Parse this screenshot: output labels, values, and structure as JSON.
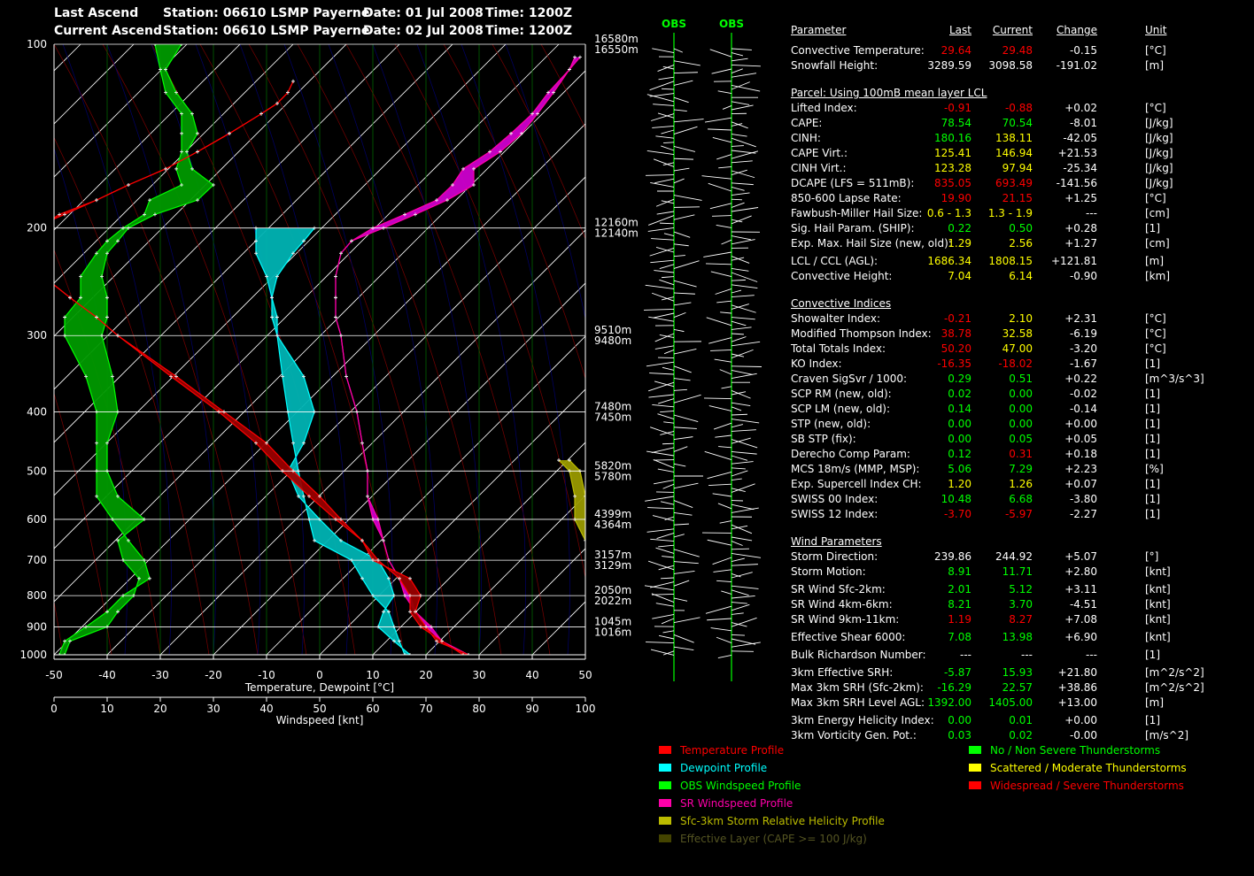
{
  "header": {
    "last_label": "Last Ascend",
    "current_label": "Current Ascend",
    "last_station": "Station: 06610 LSMP Payerne",
    "current_station": "Station: 06610 LSMP Payerne",
    "last_date": "Date: 01 Jul 2008",
    "current_date": "Date: 02 Jul 2008",
    "last_time": "Time: 1200Z",
    "current_time": "Time: 1200Z"
  },
  "colors": {
    "temperature": "#ff0000",
    "dewpoint": "#00ffff",
    "obs_wind": "#00ff00",
    "sr_wind": "#ff00aa",
    "srh": "#bbbb00",
    "effective_layer": "#444400",
    "green": "#00ff00",
    "yellow": "#ffff00",
    "red": "#ff0000",
    "fill_green": "#009900",
    "fill_red": "#990000",
    "fill_cyan": "#00b3b3",
    "fill_magenta": "#cc00cc",
    "fill_blue": "#0000aa",
    "fill_olive": "#999900"
  },
  "chart_data": {
    "type": "line",
    "xlabel": "Temperature, Dewpoint  [°C]",
    "xlabel2": "Windspeed  [knt]",
    "xlim": [
      -50,
      50
    ],
    "x2lim": [
      0,
      100
    ],
    "x_ticks": [
      "-50",
      "-40",
      "-30",
      "-20",
      "-10",
      "0",
      "10",
      "20",
      "30",
      "40",
      "50"
    ],
    "x2_ticks": [
      "0",
      "10",
      "20",
      "30",
      "40",
      "50",
      "60",
      "70",
      "80",
      "90",
      "100"
    ],
    "y_scale": "log",
    "ylim": [
      100,
      1000
    ],
    "y_ticks": [
      "100",
      "200",
      "300",
      "400",
      "500",
      "600",
      "700",
      "800",
      "900",
      "1000"
    ],
    "height_labels": [
      {
        "p": 100,
        "last": "16580m",
        "current": "16550m"
      },
      {
        "p": 200,
        "last": "12160m",
        "current": "12140m"
      },
      {
        "p": 300,
        "last": "9510m",
        "current": "9480m"
      },
      {
        "p": 400,
        "last": "7480m",
        "current": "7450m"
      },
      {
        "p": 500,
        "last": "5820m",
        "current": "5780m"
      },
      {
        "p": 600,
        "last": "4399m",
        "current": "4364m"
      },
      {
        "p": 700,
        "last": "3157m",
        "current": "3129m"
      },
      {
        "p": 800,
        "last": "2050m",
        "current": "2022m"
      },
      {
        "p": 900,
        "last": "1045m",
        "current": "1016m"
      }
    ],
    "series": [
      {
        "name": "Temperature Profile",
        "p": [
          1000,
          950,
          900,
          850,
          800,
          750,
          700,
          650,
          600,
          550,
          500,
          450,
          400,
          350,
          300,
          280,
          260,
          240,
          220,
          210,
          200,
          190,
          180,
          170,
          160,
          150,
          140,
          130,
          125,
          120,
          115
        ],
        "last": [
          28,
          22,
          20,
          18,
          19,
          17,
          10,
          8,
          4,
          0,
          -5,
          -10,
          -18,
          -27,
          -38,
          -42,
          -47,
          -52,
          -57,
          -56,
          -53,
          -49,
          -42,
          -36,
          -29,
          -23,
          -17,
          -11,
          -8,
          -6,
          -5
        ],
        "current": [
          27,
          23,
          19,
          17,
          17,
          15,
          11,
          8,
          3,
          -2,
          -7,
          -12,
          -19,
          -28,
          -38,
          -42,
          -47,
          -52,
          -57,
          -56,
          -54,
          -48,
          -42,
          -36,
          -29,
          -23,
          -17,
          -11,
          -8,
          -6,
          -5
        ]
      },
      {
        "name": "Dewpoint Profile",
        "p": [
          1000,
          950,
          900,
          850,
          800,
          750,
          700,
          650,
          600,
          550,
          500,
          450,
          400,
          350,
          300,
          280,
          260,
          240,
          220,
          210,
          200
        ],
        "last": [
          16,
          15,
          14,
          13,
          10,
          8,
          6,
          -1,
          -2,
          -3,
          -4,
          -5,
          -6,
          -7,
          -8,
          -8,
          -9,
          -10,
          -12,
          -12,
          -12
        ],
        "current": [
          17,
          14,
          11,
          12,
          14,
          13,
          11,
          4,
          0,
          -4,
          -6,
          -3,
          -1,
          -3,
          -8,
          -9,
          -9,
          -8,
          -5,
          -3,
          -1
        ]
      },
      {
        "name": "OBS Windspeed Profile",
        "p": [
          1000,
          950,
          900,
          850,
          800,
          750,
          700,
          650,
          600,
          550,
          500,
          450,
          400,
          350,
          300,
          280,
          260,
          240,
          220,
          210,
          200,
          190,
          180,
          170,
          160,
          150,
          140,
          130,
          120,
          110,
          100
        ],
        "last": [
          1,
          2,
          6,
          10,
          13,
          18,
          17,
          14,
          11,
          8,
          8,
          8,
          8,
          6,
          2,
          2,
          5,
          5,
          8,
          10,
          13,
          17,
          18,
          24,
          23,
          24,
          24,
          24,
          21,
          20,
          19
        ],
        "current": [
          2,
          3,
          10,
          12,
          15,
          16,
          13,
          12,
          17,
          12,
          10,
          10,
          12,
          11,
          9,
          10,
          10,
          9,
          10,
          12,
          14,
          19,
          27,
          30,
          26,
          25,
          27,
          26,
          23,
          21,
          24
        ]
      },
      {
        "name": "SR Windspeed Profile",
        "p": [
          1000,
          950,
          900,
          850,
          800,
          750,
          700,
          650,
          600,
          550,
          500,
          450,
          400,
          350,
          300,
          280,
          260,
          240,
          220,
          210,
          200,
          190,
          180,
          170,
          160,
          150,
          140,
          130,
          120,
          110,
          105
        ],
        "last": [
          78,
          73,
          71,
          68,
          67,
          65,
          63,
          62,
          61,
          59,
          59,
          58,
          57,
          55,
          54,
          53,
          53,
          53,
          54,
          56,
          60,
          66,
          72,
          75,
          77,
          82,
          86,
          90,
          93,
          97,
          98
        ],
        "current": [
          78,
          73,
          70,
          68,
          66,
          65,
          63,
          62,
          60,
          59,
          59,
          58,
          57,
          55,
          54,
          53,
          53,
          53,
          54,
          56,
          62,
          68,
          74,
          79,
          79,
          84,
          88,
          91,
          94,
          97,
          99
        ]
      }
    ],
    "srh_band": {
      "p": [
        900,
        850,
        800,
        750,
        700,
        650,
        600,
        550,
        500,
        480
      ],
      "last": [
        57,
        57,
        57,
        58,
        57,
        50,
        48,
        48,
        47,
        45
      ],
      "current": [
        59,
        62,
        63,
        63,
        61,
        53,
        50,
        50,
        49,
        47
      ]
    },
    "wind_barbs": {
      "labels": [
        "OBS",
        "OBS"
      ]
    },
    "legend": [
      {
        "label": "Temperature Profile",
        "color": "#ff0000",
        "swatch": "#ff0000"
      },
      {
        "label": "Dewpoint Profile",
        "color": "#00ffff",
        "swatch": "#00ffff"
      },
      {
        "label": "OBS Windspeed Profile",
        "color": "#00ff00",
        "swatch": "#00ff00"
      },
      {
        "label": "SR Windspeed Profile",
        "color": "#ff00aa",
        "swatch": "#ff00aa"
      },
      {
        "label": "Sfc-3km Storm Relative Helicity Profile",
        "color": "#bbbb00",
        "swatch": "#bbbb00"
      },
      {
        "label": "Effective Layer (CAPE >= 100 J/kg)",
        "color": "#555522",
        "swatch": "#444400"
      }
    ],
    "legend2": [
      {
        "label": "No / Non Severe Thunderstorms",
        "color": "#00ff00",
        "swatch": "#00ff00"
      },
      {
        "label": "Scattered / Moderate Thunderstorms",
        "color": "#ffff00",
        "swatch": "#ffff00"
      },
      {
        "label": "Widespread / Severe Thunderstorms",
        "color": "#ff0000",
        "swatch": "#ff0000"
      }
    ]
  },
  "table": {
    "headers": {
      "param": "Parameter",
      "last": "Last",
      "current": "Current",
      "change": "Change",
      "unit": "Unit"
    },
    "rows": [
      {
        "kind": "row",
        "label": "Convective Temperature:",
        "last": "29.64",
        "current": "29.48",
        "change": "-0.15",
        "unit": "[°C]",
        "lc": "#ff0000",
        "cc": "#ff0000"
      },
      {
        "kind": "row",
        "label": "Snowfall Height:",
        "last": "3289.59",
        "current": "3098.58",
        "change": "-191.02",
        "unit": "[m]",
        "lc": "#ffffff",
        "cc": "#ffffff"
      },
      {
        "kind": "gap"
      },
      {
        "kind": "section",
        "label": "Parcel: Using 100mB mean layer LCL"
      },
      {
        "kind": "row",
        "label": "Lifted Index:",
        "last": "-0.91",
        "current": "-0.88",
        "change": "+0.02",
        "unit": "[°C]",
        "lc": "#ff0000",
        "cc": "#ff0000"
      },
      {
        "kind": "row",
        "label": "CAPE:",
        "last": "78.54",
        "current": "70.54",
        "change": "-8.01",
        "unit": "[J/kg]",
        "lc": "#00ff00",
        "cc": "#00ff00"
      },
      {
        "kind": "row",
        "label": "CINH:",
        "last": "180.16",
        "current": "138.11",
        "change": "-42.05",
        "unit": "[J/kg]",
        "lc": "#00ff00",
        "cc": "#ffff00"
      },
      {
        "kind": "row",
        "label": "CAPE Virt.:",
        "last": "125.41",
        "current": "146.94",
        "change": "+21.53",
        "unit": "[J/kg]",
        "lc": "#ffff00",
        "cc": "#ffff00"
      },
      {
        "kind": "row",
        "label": "CINH Virt.:",
        "last": "123.28",
        "current": "97.94",
        "change": "-25.34",
        "unit": "[J/kg]",
        "lc": "#ffff00",
        "cc": "#ffff00"
      },
      {
        "kind": "row",
        "label": "DCAPE (LFS = 511mB):",
        "last": "835.05",
        "current": "693.49",
        "change": "-141.56",
        "unit": "[J/kg]",
        "lc": "#ff0000",
        "cc": "#ff0000"
      },
      {
        "kind": "row",
        "label": "850-600 Lapse Rate:",
        "last": "19.90",
        "current": "21.15",
        "change": "+1.25",
        "unit": "[°C]",
        "lc": "#ff0000",
        "cc": "#ff0000"
      },
      {
        "kind": "row",
        "label": "Fawbush-Miller Hail Size:",
        "last": "0.6 - 1.3",
        "current": "1.3 - 1.9",
        "change": "---",
        "unit": "[cm]",
        "lc": "#ffff00",
        "cc": "#ffff00"
      },
      {
        "kind": "row",
        "label": "Sig. Hail Param. (SHIP):",
        "last": "0.22",
        "current": "0.50",
        "change": "+0.28",
        "unit": "[1]",
        "lc": "#00ff00",
        "cc": "#00ff00"
      },
      {
        "kind": "row",
        "label": "Exp. Max. Hail Size (new, old):",
        "last": "1.29",
        "current": "2.56",
        "change": "+1.27",
        "unit": "[cm]",
        "lc": "#ffff00",
        "cc": "#ffff00"
      },
      {
        "kind": "halfgap"
      },
      {
        "kind": "row",
        "label": "LCL / CCL (AGL):",
        "last": "1686.34",
        "current": "1808.15",
        "change": "+121.81",
        "unit": "[m]",
        "lc": "#ffff00",
        "cc": "#ffff00"
      },
      {
        "kind": "row",
        "label": "Convective Height:",
        "last": "7.04",
        "current": "6.14",
        "change": "-0.90",
        "unit": "[km]",
        "lc": "#ffff00",
        "cc": "#ffff00"
      },
      {
        "kind": "gap"
      },
      {
        "kind": "section",
        "label": "Convective Indices"
      },
      {
        "kind": "row",
        "label": "Showalter Index:",
        "last": "-0.21",
        "current": "2.10",
        "change": "+2.31",
        "unit": "[°C]",
        "lc": "#ff0000",
        "cc": "#ffff00"
      },
      {
        "kind": "row",
        "label": "Modified Thompson Index:",
        "last": "38.78",
        "current": "32.58",
        "change": "-6.19",
        "unit": "[°C]",
        "lc": "#ff0000",
        "cc": "#ffff00"
      },
      {
        "kind": "row",
        "label": "Total Totals Index:",
        "last": "50.20",
        "current": "47.00",
        "change": "-3.20",
        "unit": "[°C]",
        "lc": "#ff0000",
        "cc": "#ffff00"
      },
      {
        "kind": "row",
        "label": "KO Index:",
        "last": "-16.35",
        "current": "-18.02",
        "change": "-1.67",
        "unit": "[1]",
        "lc": "#ff0000",
        "cc": "#ff0000"
      },
      {
        "kind": "row",
        "label": "Craven SigSvr / 1000:",
        "last": "0.29",
        "current": "0.51",
        "change": "+0.22",
        "unit": "[m^3/s^3]",
        "lc": "#00ff00",
        "cc": "#00ff00"
      },
      {
        "kind": "row",
        "label": "SCP RM (new, old):",
        "last": "0.02",
        "current": "0.00",
        "change": "-0.02",
        "unit": "[1]",
        "lc": "#00ff00",
        "cc": "#00ff00"
      },
      {
        "kind": "row",
        "label": "SCP LM (new, old):",
        "last": "0.14",
        "current": "0.00",
        "change": "-0.14",
        "unit": "[1]",
        "lc": "#00ff00",
        "cc": "#00ff00"
      },
      {
        "kind": "row",
        "label": "STP (new, old):",
        "last": "0.00",
        "current": "0.00",
        "change": "+0.00",
        "unit": "[1]",
        "lc": "#00ff00",
        "cc": "#00ff00"
      },
      {
        "kind": "row",
        "label": "SB STP (fix):",
        "last": "0.00",
        "current": "0.05",
        "change": "+0.05",
        "unit": "[1]",
        "lc": "#00ff00",
        "cc": "#00ff00"
      },
      {
        "kind": "row",
        "label": "Derecho Comp Param:",
        "last": "0.12",
        "current": "0.31",
        "change": "+0.18",
        "unit": "[1]",
        "lc": "#00ff00",
        "cc": "#ff0000"
      },
      {
        "kind": "row",
        "label": "MCS 18m/s (MMP, MSP):",
        "last": "5.06",
        "current": "7.29",
        "change": "+2.23",
        "unit": "[%]",
        "lc": "#00ff00",
        "cc": "#00ff00"
      },
      {
        "kind": "row",
        "label": "Exp. Supercell Index CH:",
        "last": "1.20",
        "current": "1.26",
        "change": "+0.07",
        "unit": "[1]",
        "lc": "#ffff00",
        "cc": "#ffff00"
      },
      {
        "kind": "row",
        "label": "SWISS 00 Index:",
        "last": "10.48",
        "current": "6.68",
        "change": "-3.80",
        "unit": "[1]",
        "lc": "#00ff00",
        "cc": "#00ff00"
      },
      {
        "kind": "row",
        "label": "SWISS 12 Index:",
        "last": "-3.70",
        "current": "-5.97",
        "change": "-2.27",
        "unit": "[1]",
        "lc": "#ff0000",
        "cc": "#ff0000"
      },
      {
        "kind": "gap"
      },
      {
        "kind": "section",
        "label": "Wind Parameters"
      },
      {
        "kind": "row",
        "label": "Storm Direction:",
        "last": "239.86",
        "current": "244.92",
        "change": "+5.07",
        "unit": "[°]",
        "lc": "#ffffff",
        "cc": "#ffffff"
      },
      {
        "kind": "row",
        "label": "Storm Motion:",
        "last": "8.91",
        "current": "11.71",
        "change": "+2.80",
        "unit": "[knt]",
        "lc": "#00ff00",
        "cc": "#00ff00"
      },
      {
        "kind": "halfgap"
      },
      {
        "kind": "row",
        "label": "SR Wind Sfc-2km:",
        "last": "2.01",
        "current": "5.12",
        "change": "+3.11",
        "unit": "[knt]",
        "lc": "#00ff00",
        "cc": "#00ff00"
      },
      {
        "kind": "row",
        "label": "SR Wind 4km-6km:",
        "last": "8.21",
        "current": "3.70",
        "change": "-4.51",
        "unit": "[knt]",
        "lc": "#00ff00",
        "cc": "#00ff00"
      },
      {
        "kind": "row",
        "label": "SR Wind 9km-11km:",
        "last": "1.19",
        "current": "8.27",
        "change": "+7.08",
        "unit": "[knt]",
        "lc": "#ff0000",
        "cc": "#ff0000"
      },
      {
        "kind": "halfgap"
      },
      {
        "kind": "row",
        "label": "Effective Shear 6000:",
        "last": "7.08",
        "current": "13.98",
        "change": "+6.90",
        "unit": "[knt]",
        "lc": "#00ff00",
        "cc": "#00ff00"
      },
      {
        "kind": "halfgap"
      },
      {
        "kind": "row",
        "label": "Bulk Richardson Number:",
        "last": "---",
        "current": "---",
        "change": "---",
        "unit": "[1]",
        "lc": "#ffffff",
        "cc": "#ffffff"
      },
      {
        "kind": "halfgap"
      },
      {
        "kind": "row",
        "label": "3km Effective SRH:",
        "last": "-5.87",
        "current": "15.93",
        "change": "+21.80",
        "unit": "[m^2/s^2]",
        "lc": "#00ff00",
        "cc": "#00ff00"
      },
      {
        "kind": "row",
        "label": "Max 3km SRH (Sfc-2km):",
        "last": "-16.29",
        "current": "22.57",
        "change": "+38.86",
        "unit": "[m^2/s^2]",
        "lc": "#00ff00",
        "cc": "#00ff00"
      },
      {
        "kind": "row",
        "label": "Max 3km SRH Level AGL:",
        "last": "1392.00",
        "current": "1405.00",
        "change": "+13.00",
        "unit": "[m]",
        "lc": "#00ff00",
        "cc": "#00ff00"
      },
      {
        "kind": "halfgap"
      },
      {
        "kind": "row",
        "label": "3km Energy Helicity Index:",
        "last": "0.00",
        "current": "0.01",
        "change": "+0.00",
        "unit": "[1]",
        "lc": "#00ff00",
        "cc": "#00ff00"
      },
      {
        "kind": "row",
        "label": "3km Vorticity Gen. Pot.:",
        "last": "0.03",
        "current": "0.02",
        "change": "-0.00",
        "unit": "[m/s^2]",
        "lc": "#00ff00",
        "cc": "#00ff00"
      }
    ]
  }
}
